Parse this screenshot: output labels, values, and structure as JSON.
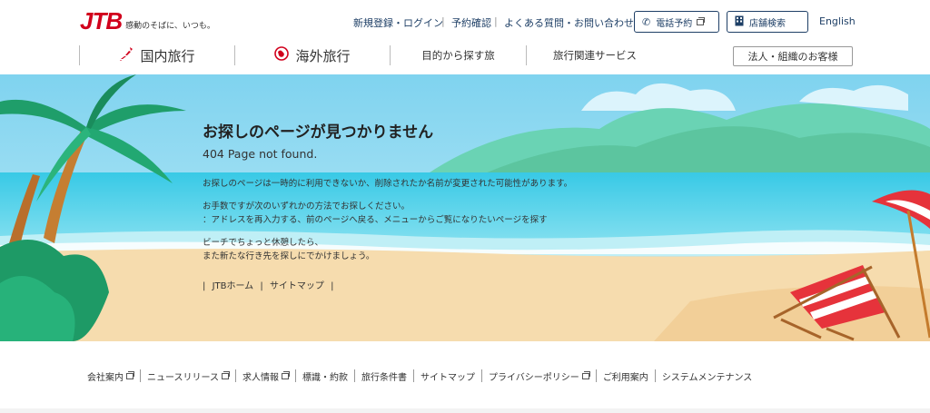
{
  "brand": {
    "logo": "JTB",
    "tagline": "感動のそばに、いつも。"
  },
  "top_links": [
    {
      "label": "新規登録・ログイン"
    },
    {
      "label": "予約確認"
    },
    {
      "label": "よくある質問・お問い合わせ"
    }
  ],
  "buttons": {
    "phone": "電話予約",
    "store": "店舗検索",
    "english": "English",
    "corporate": "法人・組織のお客様"
  },
  "nav": [
    {
      "label": "国内旅行"
    },
    {
      "label": "海外旅行"
    },
    {
      "label": "目的から探す旅"
    },
    {
      "label": "旅行関連サービス"
    }
  ],
  "error": {
    "title": "お探しのページが見つかりません",
    "subtitle": "404 Page not found.",
    "para1": "お探しのページは一時的に利用できないか、削除されたか名前が変更された可能性があります。",
    "para2_line1": "お手数ですが次のいずれかの方法でお探しください。",
    "para2_line2": "：アドレスを再入力する、前のページへ戻る、メニューからご覧になりたいページを探す",
    "para3_line1": "ビーチでちょっと休憩したら、",
    "para3_line2": "また新たな行き先を探しにでかけましょう。"
  },
  "hero_links": {
    "home": "JTBホーム",
    "sitemap": "サイトマップ"
  },
  "footer_links": [
    {
      "label": "会社案内",
      "external": true
    },
    {
      "label": "ニュースリリース",
      "external": true
    },
    {
      "label": "求人情報",
      "external": true
    },
    {
      "label": "標識・約款",
      "external": false
    },
    {
      "label": "旅行条件書",
      "external": false
    },
    {
      "label": "サイトマップ",
      "external": false
    },
    {
      "label": "プライバシーポリシー",
      "external": true
    },
    {
      "label": "ご利用案内",
      "external": false
    },
    {
      "label": "システムメンテナンス",
      "external": false
    }
  ],
  "colors": {
    "brand_red": "#d1001c",
    "navy": "#1e3f66",
    "sky": "#8fd8f0",
    "sea": "#2fc6e8",
    "sand": "#f6dcae"
  }
}
